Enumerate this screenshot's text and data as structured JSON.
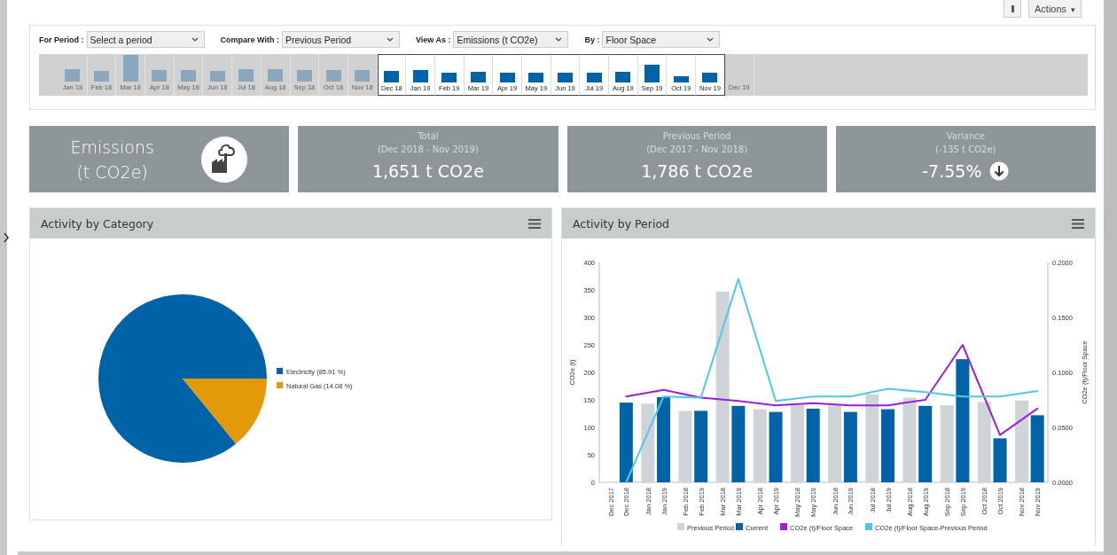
{
  "toolbar": {
    "actions_label": "Actions",
    "caret": "▾"
  },
  "filters": [
    {
      "label": "For Period :",
      "value": "Select a period"
    },
    {
      "label": "Compare With :",
      "value": "Previous Period"
    },
    {
      "label": "View As :",
      "value": "Emissions (t CO2e)"
    },
    {
      "label": "By :",
      "value": "Floor Space"
    }
  ],
  "timeline": [
    {
      "label": "Jan 18",
      "selected": false
    },
    {
      "label": "Feb 18",
      "selected": false
    },
    {
      "label": "Mar 18",
      "selected": false
    },
    {
      "label": "Apr 18",
      "selected": false
    },
    {
      "label": "May 18",
      "selected": false
    },
    {
      "label": "Jun 18",
      "selected": false
    },
    {
      "label": "Jul 18",
      "selected": false
    },
    {
      "label": "Aug 18",
      "selected": false
    },
    {
      "label": "Sep 18",
      "selected": false
    },
    {
      "label": "Oct 18",
      "selected": false
    },
    {
      "label": "Nov 18",
      "selected": false
    },
    {
      "label": "Dec 18",
      "selected": true
    },
    {
      "label": "Jan 19",
      "selected": true
    },
    {
      "label": "Feb 19",
      "selected": true
    },
    {
      "label": "Mar 19",
      "selected": true
    },
    {
      "label": "Apr 19",
      "selected": true
    },
    {
      "label": "May 19",
      "selected": true
    },
    {
      "label": "Jun 19",
      "selected": true
    },
    {
      "label": "Jul 19",
      "selected": true
    },
    {
      "label": "Aug 19",
      "selected": true
    },
    {
      "label": "Sep 19",
      "selected": true
    },
    {
      "label": "Oct 19",
      "selected": true
    },
    {
      "label": "Nov 19",
      "selected": true
    },
    {
      "label": "Dec 19",
      "selected": false
    }
  ],
  "cards": [
    {
      "kind": "heading",
      "title": "Emissions",
      "subtitle": "(t CO2e)"
    },
    {
      "kind": "stat",
      "title": "Total",
      "subtitle": "(Dec 2018 - Nov 2019)",
      "value": "1,651 t CO2e"
    },
    {
      "kind": "stat",
      "title": "Previous Period",
      "subtitle": "(Dec 2017 - Nov 2018)",
      "value": "1,786 t CO2e"
    },
    {
      "kind": "variance",
      "title": "Variance",
      "subtitle": "(-135 t CO2e)",
      "value": "-7.55%"
    }
  ],
  "category_panel": {
    "title": "Activity by Category",
    "chart_data": {
      "type": "pie",
      "categories": [
        "Electricity (85.91 %)",
        "Natural Gas (14.08 %)"
      ],
      "legend": true,
      "series": [
        {
          "values": [
            85.91,
            14.08
          ],
          "colors": [
            "#0063a8",
            "#e39a0a"
          ]
        }
      ]
    }
  },
  "period_panel": {
    "title": "Activity by Period",
    "chart_data": {
      "type": "bar",
      "ylabel": "CO2e (t)",
      "y2label": "CO2e (t)/Floor Space",
      "ylim": [
        0,
        400
      ],
      "y2lim": [
        0,
        0.2
      ],
      "legend": true,
      "yticks": [
        0,
        50,
        100,
        150,
        200,
        250,
        300,
        350,
        400
      ],
      "y2ticks": [
        {
          "value": 0,
          "label": "0.0000"
        },
        {
          "value": 0.05,
          "label": "0.0500"
        },
        {
          "value": 0.1,
          "label": "0.1000"
        },
        {
          "value": 0.15,
          "label": "0.1500"
        },
        {
          "value": 0.2,
          "label": "0.2000"
        }
      ],
      "categories": [
        "Dec 2017",
        "Dec 2018",
        "Jan 2018",
        "Jan 2019",
        "Feb 2018",
        "Feb 2019",
        "Mar 2018",
        "Mar 2019",
        "Apr 2018",
        "Apr 2019",
        "May 2018",
        "May 2019",
        "Jun 2018",
        "Jun 2019",
        "Jul 2018",
        "Jul 2019",
        "Aug 2018",
        "Aug 2019",
        "Sep 2018",
        "Sep 2019",
        "Oct 2018",
        "Oct 2019",
        "Nov 2018",
        "Nov 2019"
      ],
      "series": [
        {
          "name": "Previous Period",
          "type": "bar",
          "color": "#cfd4d8",
          "values": [
            0,
            null,
            143,
            null,
            130,
            null,
            347,
            null,
            133,
            null,
            143,
            null,
            140,
            null,
            160,
            null,
            154,
            null,
            140,
            null,
            146,
            null,
            149,
            null
          ]
        },
        {
          "name": "Current",
          "type": "bar",
          "color": "#0063a8",
          "values": [
            null,
            145,
            null,
            155,
            null,
            130,
            null,
            139,
            null,
            128,
            null,
            134,
            null,
            128,
            null,
            133,
            null,
            139,
            null,
            224,
            null,
            80,
            null,
            122
          ]
        },
        {
          "name": "CO2e (t)/Floor Space",
          "type": "line",
          "axis": "y2",
          "color": "#9b1fd6",
          "values": [
            null,
            0.078,
            null,
            0.084,
            null,
            0.077,
            null,
            0.074,
            null,
            0.07,
            null,
            0.072,
            null,
            0.07,
            null,
            0.07,
            null,
            0.075,
            null,
            0.125,
            null,
            0.043,
            null,
            0.067
          ]
        },
        {
          "name": "CO2e (t)/Floor Space-Previous Period",
          "type": "line",
          "axis": "y2",
          "color": "#4ec8ea",
          "values": [
            null,
            0,
            null,
            0.078,
            null,
            0.077,
            null,
            0.185,
            null,
            0.074,
            null,
            0.078,
            null,
            0.078,
            null,
            0.085,
            null,
            0.082,
            null,
            0.078,
            null,
            0.078,
            null,
            0.083
          ]
        }
      ]
    }
  }
}
